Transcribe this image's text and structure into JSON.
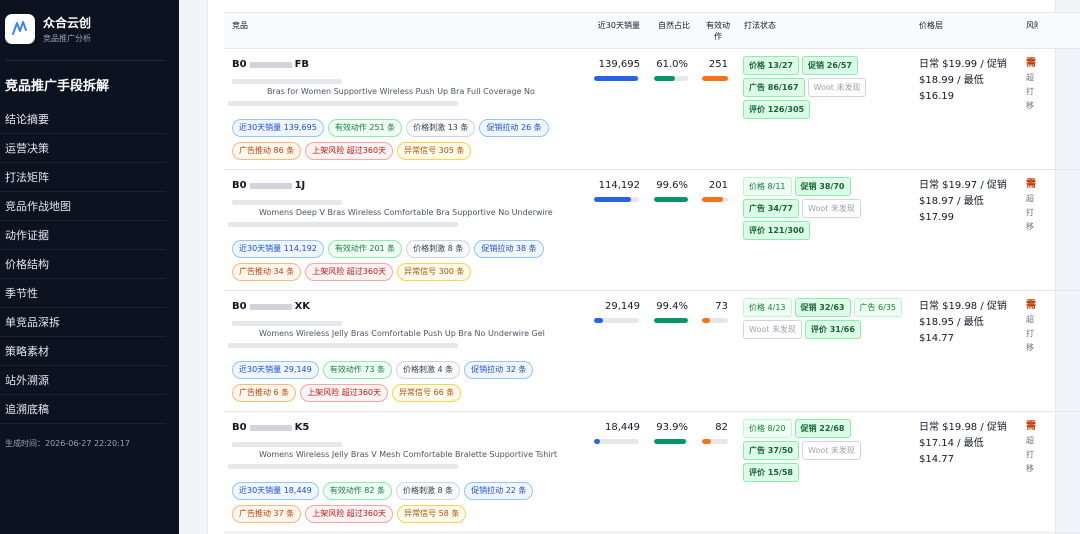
{
  "brand": {
    "name": "众合云创",
    "subtitle": "竞品推广分析"
  },
  "sidebar": {
    "title": "竞品推广手段拆解",
    "items": [
      "结论摘要",
      "运营决策",
      "打法矩阵",
      "竞品作战地图",
      "动作证据",
      "价格结构",
      "季节性",
      "单竞品深拆",
      "策略素材",
      "站外溯源",
      "追溯底稿"
    ],
    "generated": "生成时间：2026-06-27 22:20:17"
  },
  "table": {
    "headers": {
      "product": "竞品",
      "sales": "近30天销量",
      "natural": "自然占比",
      "actions": "有效动作",
      "play": "打法状态",
      "price": "价格层",
      "risk": "风险"
    }
  },
  "rows": [
    {
      "code_prefix": "B0",
      "code_suffix": "FB",
      "title": "Bras for Women Supportive Wireless Push Up Bra Full Coverage No",
      "sales": "139,695",
      "sales_pct": 0.98,
      "natural": "61.0%",
      "natural_pct": 0.61,
      "actions": "251",
      "action_pct": 1.0,
      "tags1": [
        [
          "近30天销量",
          "139,695",
          "blue"
        ],
        [
          "有效动作",
          "251 条",
          "green"
        ],
        [
          "价格刺激",
          "13 条",
          "gray"
        ],
        [
          "促销拉动",
          "26 条",
          "blue"
        ]
      ],
      "tags2": [
        [
          "广告推动",
          "86 条",
          "orange"
        ],
        [
          "上架风险",
          "超过360天",
          "red"
        ],
        [
          "异常信号",
          "305 条",
          "yellow"
        ]
      ],
      "plays": [
        [
          "价格 13/27",
          "on"
        ],
        [
          "促销 26/57",
          "on"
        ],
        [
          "广告 86/167",
          "on"
        ],
        [
          "Woot 未发现",
          "off"
        ],
        [
          "评价 126/305",
          "on"
        ]
      ],
      "price": [
        "日常 $19.99 / 促销",
        "$18.99 / 最低",
        "$16.19"
      ],
      "risk": [
        "需",
        "超",
        "打",
        "移"
      ]
    },
    {
      "code_prefix": "B0",
      "code_suffix": "1J",
      "title": "Womens Deep V Bras Wireless Comfortable Bra Supportive No Underwire",
      "sales": "114,192",
      "sales_pct": 0.82,
      "natural": "99.6%",
      "natural_pct": 0.996,
      "actions": "201",
      "action_pct": 0.8,
      "tags1": [
        [
          "近30天销量",
          "114,192",
          "blue"
        ],
        [
          "有效动作",
          "201 条",
          "green"
        ],
        [
          "价格刺激",
          "8 条",
          "gray"
        ],
        [
          "促销拉动",
          "38 条",
          "blue"
        ]
      ],
      "tags2": [
        [
          "广告推动",
          "34 条",
          "orange"
        ],
        [
          "上架风险",
          "超过360天",
          "red"
        ],
        [
          "异常信号",
          "300 条",
          "yellow"
        ]
      ],
      "plays": [
        [
          "价格 8/11",
          "mid"
        ],
        [
          "促销 38/70",
          "on"
        ],
        [
          "广告 34/77",
          "on"
        ],
        [
          "Woot 未发现",
          "off"
        ],
        [
          "评价 121/300",
          "on"
        ]
      ],
      "price": [
        "日常 $19.97 / 促销",
        "$18.97 / 最低",
        "$17.99"
      ],
      "risk": [
        "需",
        "超",
        "打",
        "移"
      ]
    },
    {
      "code_prefix": "B0",
      "code_suffix": "XK",
      "title": "Womens Wireless Jelly Bras Comfortable Push Up Bra No Underwire Gel",
      "sales": "29,149",
      "sales_pct": 0.21,
      "natural": "99.4%",
      "natural_pct": 0.994,
      "actions": "73",
      "action_pct": 0.29,
      "tags1": [
        [
          "近30天销量",
          "29,149",
          "blue"
        ],
        [
          "有效动作",
          "73 条",
          "green"
        ],
        [
          "价格刺激",
          "4 条",
          "gray"
        ],
        [
          "促销拉动",
          "32 条",
          "blue"
        ]
      ],
      "tags2": [
        [
          "广告推动",
          "6 条",
          "orange"
        ],
        [
          "上架风险",
          "超过360天",
          "red"
        ],
        [
          "异常信号",
          "66 条",
          "yellow"
        ]
      ],
      "plays": [
        [
          "价格 4/13",
          "mid"
        ],
        [
          "促销 32/63",
          "on"
        ],
        [
          "广告 6/35",
          "mid"
        ],
        [
          "Woot 未发现",
          "off"
        ],
        [
          "评价 31/66",
          "on"
        ]
      ],
      "price": [
        "日常 $19.98 / 促销",
        "$18.95 / 最低",
        "$14.77"
      ],
      "risk": [
        "需",
        "超",
        "打",
        "移"
      ]
    },
    {
      "code_prefix": "B0",
      "code_suffix": "K5",
      "title": "Womens Wireless Jelly Bras V Mesh Comfortable Bralette Supportive Tshirt",
      "sales": "18,449",
      "sales_pct": 0.13,
      "natural": "93.9%",
      "natural_pct": 0.939,
      "actions": "82",
      "action_pct": 0.33,
      "tags1": [
        [
          "近30天销量",
          "18,449",
          "blue"
        ],
        [
          "有效动作",
          "82 条",
          "green"
        ],
        [
          "价格刺激",
          "8 条",
          "gray"
        ],
        [
          "促销拉动",
          "22 条",
          "blue"
        ]
      ],
      "tags2": [
        [
          "广告推动",
          "37 条",
          "orange"
        ],
        [
          "上架风险",
          "超过360天",
          "red"
        ],
        [
          "异常信号",
          "58 条",
          "yellow"
        ]
      ],
      "plays": [
        [
          "价格 8/20",
          "mid"
        ],
        [
          "促销 22/68",
          "on"
        ],
        [
          "广告 37/50",
          "on"
        ],
        [
          "Woot 未发现",
          "off"
        ],
        [
          "评价 15/58",
          "on"
        ]
      ],
      "price": [
        "日常 $19.98 / 促销",
        "$17.14 / 最低",
        "$14.77"
      ],
      "risk": [
        "需",
        "超",
        "打",
        "移"
      ]
    }
  ],
  "colors": {
    "bar_blue": "#2563eb",
    "bar_green": "#059669",
    "bar_orange": "#f97316"
  }
}
